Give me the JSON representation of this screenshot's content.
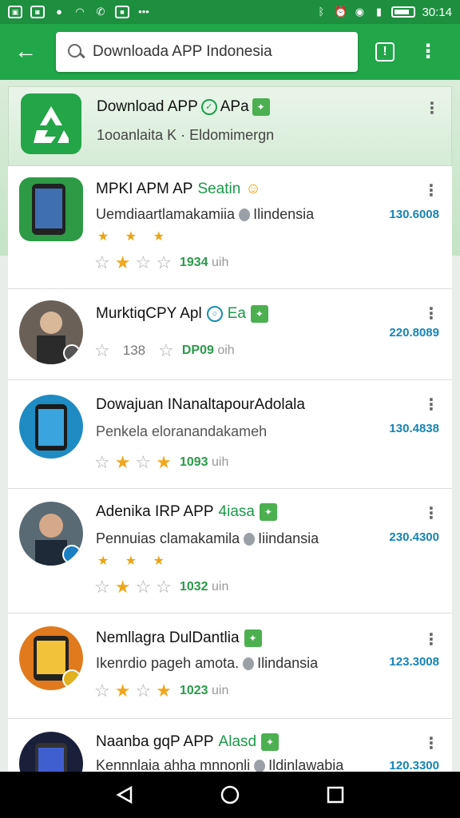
{
  "status_bar": {
    "time": "30:14"
  },
  "search": {
    "query": "Downloada APP Indonesia"
  },
  "header": {
    "title": "Download APP",
    "title_tag": "APa",
    "subtitle": "1ooanlaita K · Eldomimergn"
  },
  "apps": [
    {
      "title": "MPKI APM AP",
      "tag": "Seatin",
      "subtitle": "Uemdiaartlamakamiia",
      "location": "Ilindensia",
      "price": "130.6008",
      "small_stars": "★ ★ ★",
      "rating_count": "1934",
      "rating_unit": "uih",
      "stars": [
        "empty",
        "full",
        "empty",
        "empty"
      ]
    },
    {
      "title": "MurktiqCPY Apl",
      "tag": "Ea",
      "subtitle": "",
      "location": "",
      "price": "220.8089",
      "small_stars": "",
      "rating_count": "DP09",
      "rating_unit": "oih",
      "mid_text": "138",
      "stars": [
        "empty",
        "empty"
      ]
    },
    {
      "title": "Dowajuan INanaltapourAdolala",
      "tag": "",
      "subtitle": "Penkela eloranandakameh",
      "location": "",
      "price": "130.4838",
      "small_stars": "",
      "rating_count": "1093",
      "rating_unit": "uih",
      "stars": [
        "empty",
        "full",
        "empty",
        "full"
      ]
    },
    {
      "title": "Adenika IRP APP",
      "tag": "4iasa",
      "subtitle": "Pennuias clamakamila",
      "location": "Iiindansia",
      "price": "230.4300",
      "small_stars": "★ ★ ★",
      "rating_count": "1032",
      "rating_unit": "uin",
      "stars": [
        "empty",
        "full",
        "empty",
        "empty"
      ]
    },
    {
      "title": "Nemllagra DulDantlia",
      "tag": "",
      "subtitle": "Ikenrdio pageh amota.",
      "location": "Ilindansia",
      "price": "123.3008",
      "small_stars": "",
      "rating_count": "1023",
      "rating_unit": "uin",
      "stars": [
        "empty",
        "full",
        "empty",
        "full"
      ]
    },
    {
      "title": "Naanba gqP APP",
      "tag": "Alasd",
      "subtitle": "Kennnlaia ahha mnnonli",
      "location": "Ildinlawabia",
      "price": "120.3300",
      "small_stars": "",
      "rating_count": "",
      "rating_unit": "",
      "stars": []
    }
  ],
  "colors": {
    "primary": "#22a64a",
    "status": "#1e8f3f",
    "price": "#1684b5",
    "star": "#f0a71e"
  }
}
